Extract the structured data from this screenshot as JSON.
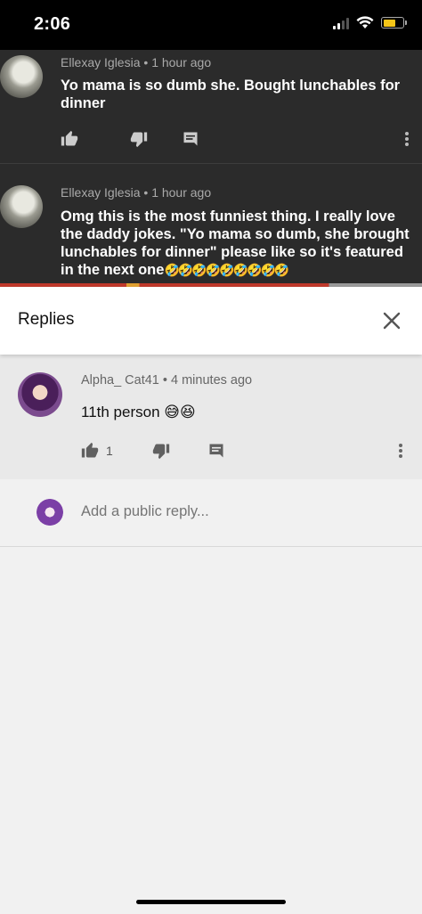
{
  "status_bar": {
    "time": "2:06",
    "battery_level": 0.65,
    "battery_color": "#f5c518"
  },
  "comments": [
    {
      "author": "Ellexay Iglesia",
      "separator": "•",
      "time_ago": "1 hour ago",
      "text": "Yo mama is so dumb she. Bought lunchables for dinner"
    },
    {
      "author": "Ellexay Iglesia",
      "separator": "•",
      "time_ago": "1 hour ago",
      "text": "Omg this is the most funniest thing. I really love the daddy jokes. \"Yo mama so dumb, she brought lunchables for dinner\" please like so it's featured in the next one",
      "emojis": "🤣🤣🤣🤣🤣🤣🤣🤣🤣"
    }
  ],
  "replies_panel": {
    "title": "Replies",
    "close_icon": "close-icon"
  },
  "reply": {
    "author": "Alpha_ Cat41",
    "separator": "•",
    "time_ago": "4 minutes ago",
    "text": "11th person 😅😆",
    "like_count": "1"
  },
  "add_reply": {
    "placeholder": "Add a public reply..."
  },
  "colors": {
    "dark_bg": "#2b2b2b",
    "panel_bg": "#ffffff",
    "reply_bg": "#e9e9e9"
  }
}
